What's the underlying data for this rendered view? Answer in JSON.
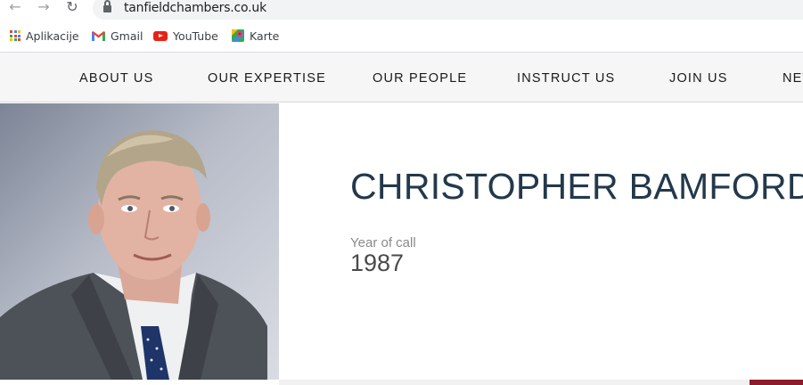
{
  "browser": {
    "url": "tanfieldchambers.co.uk",
    "bookmarks": [
      {
        "label": "Aplikacije",
        "icon": "apps-grid-icon"
      },
      {
        "label": "Gmail",
        "icon": "gmail-icon"
      },
      {
        "label": "YouTube",
        "icon": "youtube-icon"
      },
      {
        "label": "Karte",
        "icon": "maps-icon"
      }
    ]
  },
  "nav": {
    "items": [
      {
        "label": "ABOUT US"
      },
      {
        "label": "OUR EXPERTISE"
      },
      {
        "label": "OUR PEOPLE"
      },
      {
        "label": "INSTRUCT US"
      },
      {
        "label": "JOIN US"
      },
      {
        "label": "NEWS"
      }
    ]
  },
  "profile": {
    "name": "CHRISTOPHER BAMFORD",
    "year_of_call_label": "Year of call",
    "year_of_call": "1987"
  },
  "colors": {
    "name_text": "#23394b",
    "accent": "#8c1c2b",
    "nav_bg": "#f6f6f6"
  }
}
